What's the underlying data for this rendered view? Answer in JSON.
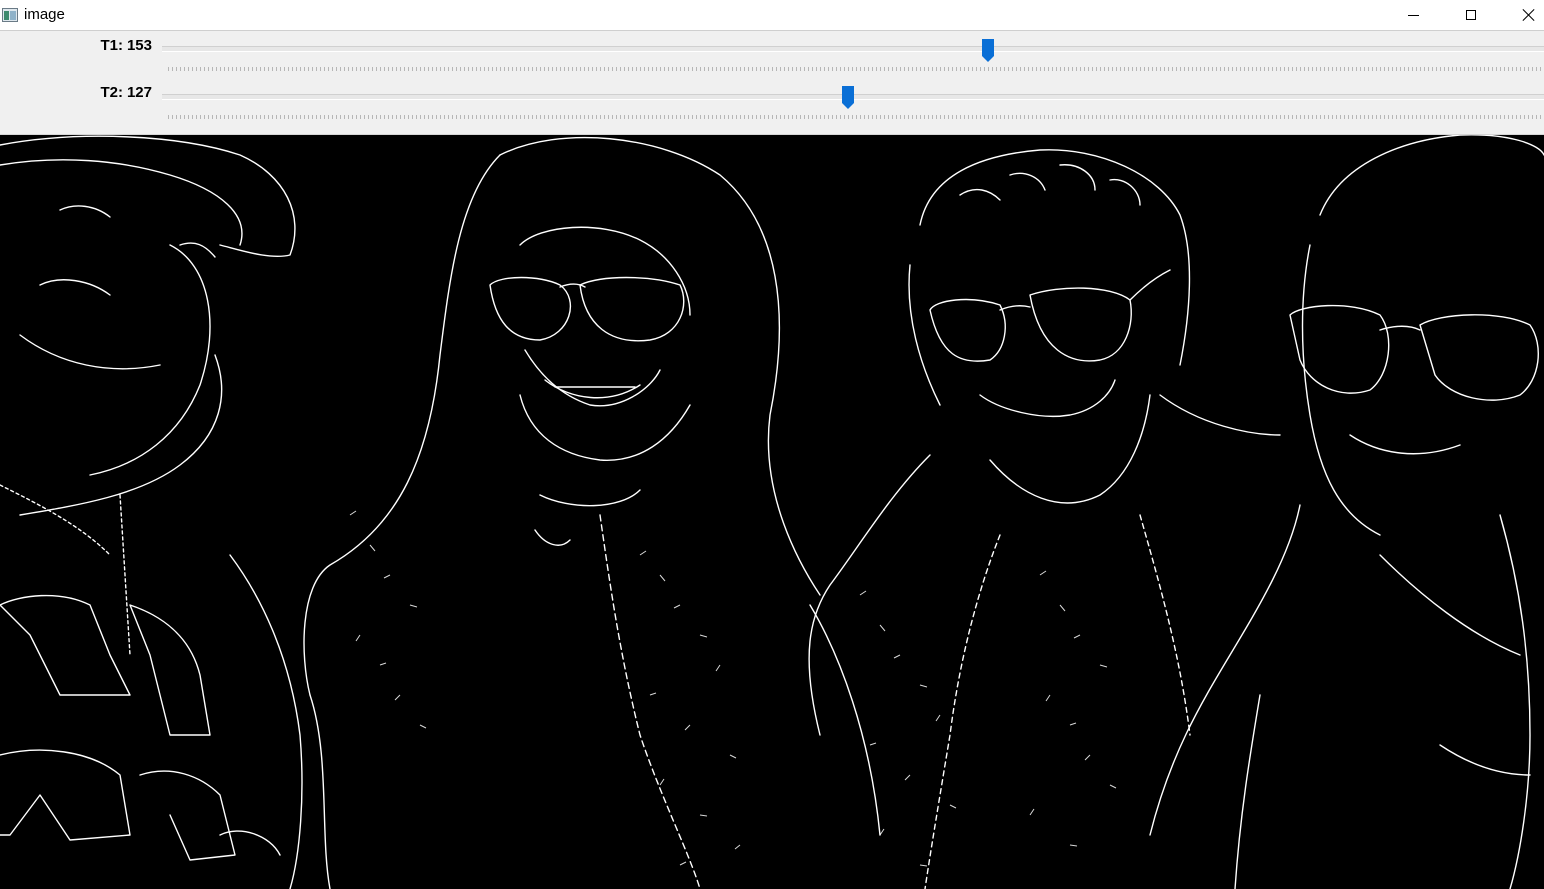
{
  "window": {
    "title": "image",
    "icon": "image-window-icon"
  },
  "controls": {
    "minimize_icon": "minimize-icon",
    "maximize_icon": "maximize-icon",
    "close_icon": "close-icon"
  },
  "trackbars": [
    {
      "name": "T1",
      "value": "153",
      "fraction": 0.5978
    },
    {
      "name": "T2",
      "value": "127",
      "fraction": 0.4961
    }
  ],
  "colors": {
    "thumb": "#0a6fd6",
    "image_background": "#000000",
    "edges": "#ffffff"
  }
}
